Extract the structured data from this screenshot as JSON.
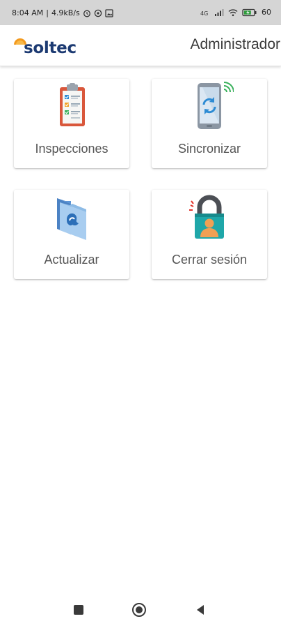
{
  "status_bar": {
    "time": "8:04 AM",
    "speed": "4.9kB/s",
    "battery": "60"
  },
  "header": {
    "logo_text": "soltec",
    "user_label": "Administrador"
  },
  "tiles": [
    {
      "label": "Inspecciones",
      "icon": "clipboard-checklist-icon"
    },
    {
      "label": "Sincronizar",
      "icon": "phone-sync-icon"
    },
    {
      "label": "Actualizar",
      "icon": "folder-upload-icon"
    },
    {
      "label": "Cerrar sesión",
      "icon": "padlock-user-icon"
    }
  ],
  "colors": {
    "logo_blue": "#1c3a72",
    "logo_orange": "#f39a1e"
  },
  "nav": {
    "recents_icon": "recents-icon",
    "home_icon": "home-icon",
    "back_icon": "back-icon"
  }
}
